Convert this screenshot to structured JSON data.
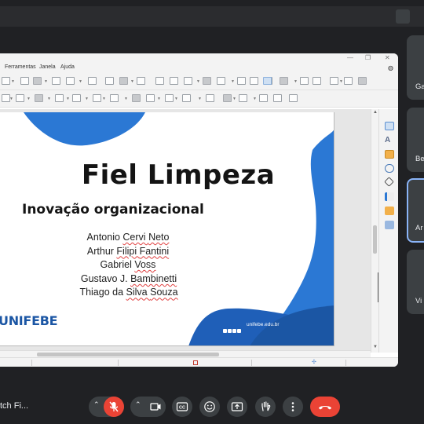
{
  "slide_window": {
    "menu": [
      "Ferramentas",
      "Janela",
      "Ajuda"
    ],
    "slide": {
      "title": "Fiel Limpeza",
      "subtitle": "Inovação organizacional",
      "authors": [
        "Antonio Cervi Neto",
        "Arthur Filipi Fantini",
        "Gabriel Voss",
        "Gustavo J. Bambinetti",
        "Thiago da Silva Souza"
      ],
      "logo": "UNIFEBE",
      "footer_url": "unifebe.edu.br"
    }
  },
  "participants": [
    "Ga",
    "Be",
    "Ar",
    "Vi"
  ],
  "meeting": {
    "name": "tch Fi..."
  },
  "colors": {
    "meet_bg": "#202124",
    "control_bg": "#3c4043",
    "end_call": "#ea4335",
    "slide_blue": "#1b56a4",
    "slide_blue_light": "#2b78d4",
    "active_border": "#8ab4f8"
  },
  "icons": [
    "mic-off-icon",
    "camera-icon",
    "captions-icon",
    "emoji-icon",
    "present-icon",
    "hand-icon",
    "more-icon",
    "end-call-icon"
  ]
}
